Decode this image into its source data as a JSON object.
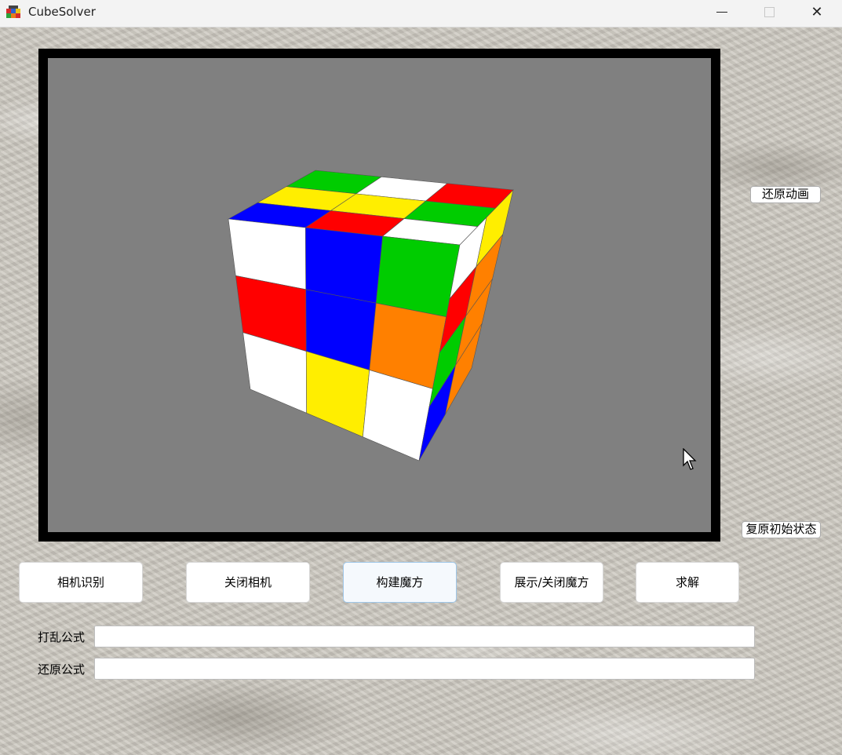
{
  "titlebar": {
    "title": "CubeSolver",
    "app_icon": "rubiks-cube-icon",
    "min_icon": "minimize-icon",
    "max_icon": "maximize-icon",
    "close_icon": "close-icon",
    "close_glyph": "✕"
  },
  "side_buttons": {
    "restore_animation": "还原动画",
    "reset_initial_state": "复原初始状态"
  },
  "buttons": {
    "camera_recognize": "相机识别",
    "close_camera": "关闭相机",
    "build_cube": "构建魔方",
    "show_hide_cube": "展示/关闭魔方",
    "solve": "求解"
  },
  "fields": {
    "scramble_label": "打乱公式",
    "scramble_value": "",
    "restore_label": "还原公式",
    "restore_value": ""
  },
  "colors": {
    "viewport_bg": "#808080",
    "white": "#ffffff",
    "red": "#ff0000",
    "blue": "#0000ff",
    "green": "#00cc00",
    "yellow": "#ffee00",
    "orange": "#ff8000"
  },
  "cube_state": {
    "top": [
      [
        "green",
        "white",
        "red"
      ],
      [
        "yellow",
        "yellow",
        "green"
      ],
      [
        "blue",
        "red",
        "white"
      ]
    ],
    "front": [
      [
        "white",
        "blue",
        "green"
      ],
      [
        "red",
        "blue",
        "orange"
      ],
      [
        "white",
        "yellow",
        "white"
      ]
    ],
    "right": [
      [
        "white",
        "yellow"
      ],
      [
        "red",
        "orange"
      ],
      [
        "green",
        "orange"
      ],
      [
        "blue",
        "orange"
      ]
    ]
  }
}
